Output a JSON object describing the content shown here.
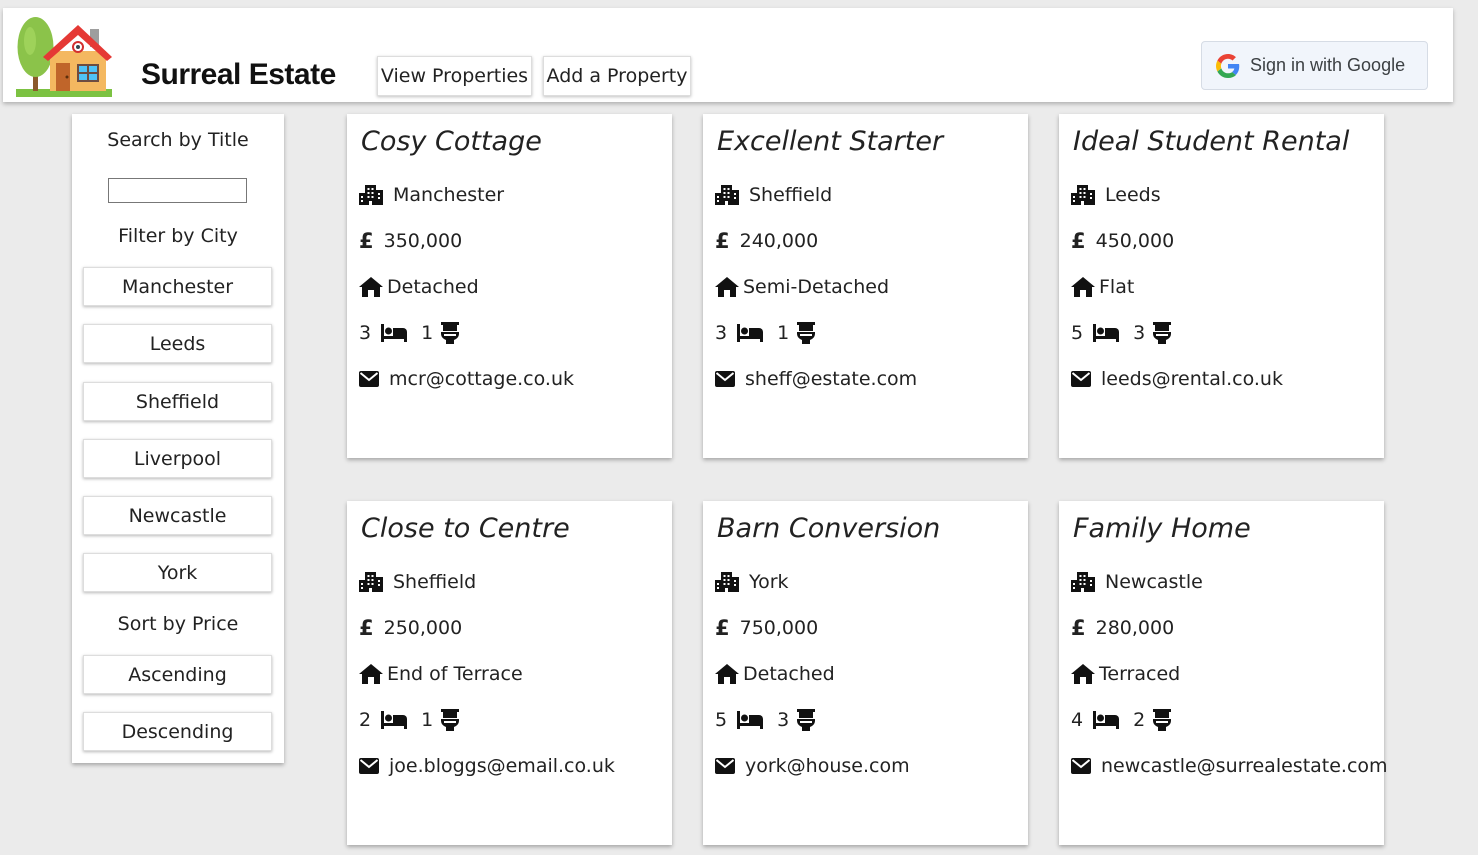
{
  "header": {
    "brand": "Surreal Estate",
    "nav": [
      "View Properties",
      "Add a Property"
    ],
    "signin_label": "Sign in with Google"
  },
  "sidebar": {
    "search_label": "Search by Title",
    "search_value": "",
    "filter_label": "Filter by City",
    "cities": [
      "Manchester",
      "Leeds",
      "Sheffield",
      "Liverpool",
      "Newcastle",
      "York"
    ],
    "sort_label": "Sort by Price",
    "sort_options": [
      "Ascending",
      "Descending"
    ]
  },
  "properties": [
    {
      "title": "Cosy Cottage",
      "city": "Manchester",
      "price": "350,000",
      "type": "Detached",
      "bedrooms": "3",
      "bathrooms": "1",
      "email": "mcr@cottage.co.uk"
    },
    {
      "title": "Excellent Starter",
      "city": "Sheffield",
      "price": "240,000",
      "type": "Semi-Detached",
      "bedrooms": "3",
      "bathrooms": "1",
      "email": "sheff@estate.com"
    },
    {
      "title": "Ideal Student Rental",
      "city": "Leeds",
      "price": "450,000",
      "type": "Flat",
      "bedrooms": "5",
      "bathrooms": "3",
      "email": "leeds@rental.co.uk"
    },
    {
      "title": "Close to Centre",
      "city": "Sheffield",
      "price": "250,000",
      "type": "End of Terrace",
      "bedrooms": "2",
      "bathrooms": "1",
      "email": "joe.bloggs@email.co.uk"
    },
    {
      "title": "Barn Conversion",
      "city": "York",
      "price": "750,000",
      "type": "Detached",
      "bedrooms": "5",
      "bathrooms": "3",
      "email": "york@house.com"
    },
    {
      "title": "Family Home",
      "city": "Newcastle",
      "price": "280,000",
      "type": "Terraced",
      "bedrooms": "4",
      "bathrooms": "2",
      "email": "newcastle@surrealestate.com"
    }
  ],
  "icons": {
    "logo": "house-logo-icon",
    "city": "city-buildings-icon",
    "price": "pound-sign-icon",
    "type": "home-icon",
    "bedrooms": "bed-icon",
    "bathrooms": "toilet-icon",
    "email": "envelope-icon",
    "signin": "google-g-icon"
  },
  "colors": {
    "background": "#ebebeb",
    "card": "#ffffff",
    "google_button_bg": "#f1f5fb"
  }
}
